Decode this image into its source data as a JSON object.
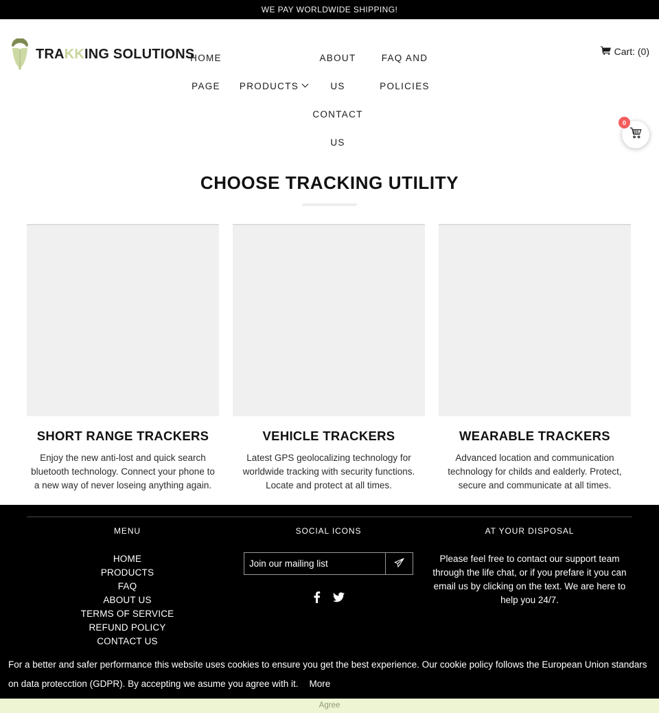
{
  "announcement": {
    "text": "WE PAY WORLDWIDE SHIPPING!"
  },
  "header": {
    "logo": {
      "prefix": "TRA",
      "accent": "KK",
      "suffix": "ING SOLUTIONS",
      "accent_color": "#c8d49a"
    },
    "nav": [
      {
        "label": "HOME PAGE"
      },
      {
        "label": "PRODUCTS"
      },
      {
        "label": "ABOUT US"
      },
      {
        "label": "FAQ AND POLICIES"
      },
      {
        "label": "CONTACT US"
      }
    ],
    "nav_lines": {
      "home": "HOME",
      "page": "PAGE",
      "products": "PRODUCTS",
      "about": "ABOUT",
      "about2": "US",
      "faq": "FAQ AND",
      "faq2": "POLICIES",
      "contact": "CONTACT",
      "contact2": "US"
    },
    "cart_link": "Cart: (0)"
  },
  "float_cart": {
    "count": "0"
  },
  "section": {
    "title": "CHOOSE TRACKING UTILITY",
    "cards": [
      {
        "title": "SHORT RANGE TRACKERS",
        "desc": "Enjoy the new anti-lost and quick search bluetooth technology. Connect your phone to a new way of never loseing anything again."
      },
      {
        "title": "VEHICLE TRACKERS",
        "desc": "Latest GPS geolocalizing technology for worldwide tracking with security functions. Locate and protect at all times."
      },
      {
        "title": "WEARABLE TRACKERS",
        "desc": "Advanced location and communication technology for childs and ealderly. Protect, secure and communicate at all times."
      }
    ]
  },
  "footer": {
    "menu": {
      "heading": "MENU",
      "items": [
        {
          "label": "HOME"
        },
        {
          "label": "PRODUCTS"
        },
        {
          "label": "FAQ"
        },
        {
          "label": "ABOUT US"
        },
        {
          "label": "TERMS OF SERVICE"
        },
        {
          "label": "REFUND POLICY"
        },
        {
          "label": "CONTACT US"
        }
      ]
    },
    "social": {
      "heading": "SOCIAL ICONS",
      "newsletter_placeholder": "Join our mailing list",
      "newsletter_value": "",
      "icons": [
        {
          "name": "facebook"
        },
        {
          "name": "twitter"
        }
      ]
    },
    "help": {
      "heading": "AT YOUR DISPOSAL",
      "text": "Please feel free to contact our support team through the life chat, or if you prefare it you can email us by clicking on the text. We are here to help you 24/7."
    }
  },
  "cookie": {
    "text": "For a better and safer performance this website uses cookies to ensure you get the best experience. Our cookie policy follows the European Union standars on data protecction (GDPR). By accepting we asume you agree with it.",
    "more": "More",
    "agree": "Agree",
    "agree_bg": "#eef5d3"
  }
}
